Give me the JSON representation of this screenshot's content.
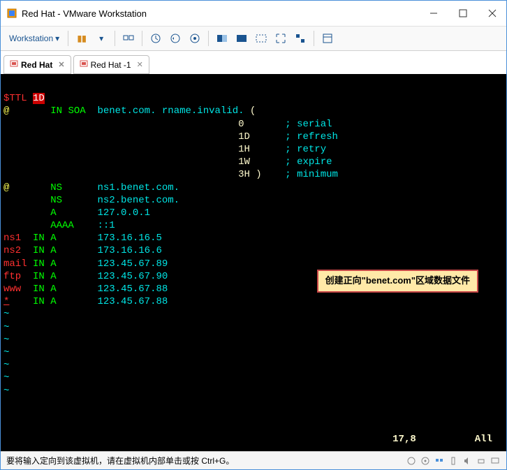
{
  "window": {
    "title": "Red Hat  - VMware Workstation"
  },
  "toolbar": {
    "menu_label": "Workstation"
  },
  "tabs": [
    {
      "label": "Red Hat"
    },
    {
      "label": "Red Hat -1"
    }
  ],
  "terminal": {
    "ttl_label": "$TTL",
    "ttl_value": "1D",
    "soa_owner": "@",
    "soa_in": "IN",
    "soa_type": "SOA",
    "soa_domain": "benet.com.",
    "soa_rname": "rname.invalid.",
    "soa_open": "(",
    "soa_params": [
      {
        "value": "0",
        "comment": "; serial"
      },
      {
        "value": "1D",
        "comment": "; refresh"
      },
      {
        "value": "1H",
        "comment": "; retry"
      },
      {
        "value": "1W",
        "comment": "; expire"
      },
      {
        "value": "3H )",
        "comment": "; minimum"
      }
    ],
    "records": [
      {
        "owner": "@",
        "in": "",
        "type": "NS",
        "data": "ns1.benet.com."
      },
      {
        "owner": "",
        "in": "",
        "type": "NS",
        "data": "ns2.benet.com."
      },
      {
        "owner": "",
        "in": "",
        "type": "A",
        "data": "127.0.0.1"
      },
      {
        "owner": "",
        "in": "",
        "type": "AAAA",
        "data": "::1"
      },
      {
        "owner": "ns1",
        "in": "IN",
        "type": "A",
        "data": "173.16.16.5"
      },
      {
        "owner": "ns2",
        "in": "IN",
        "type": "A",
        "data": "173.16.16.6"
      },
      {
        "owner": "mail",
        "in": "IN",
        "type": "A",
        "data": "123.45.67.89"
      },
      {
        "owner": "ftp",
        "in": "IN",
        "type": "A",
        "data": "123.45.67.90"
      },
      {
        "owner": "www",
        "in": "IN",
        "type": "A",
        "data": "123.45.67.88"
      },
      {
        "owner": "*",
        "in": "IN",
        "type": "A",
        "data": "123.45.67.88"
      }
    ],
    "annotation": "创建正向\"benet.com\"区域数据文件",
    "cursor_pos": "17,8",
    "view_mode": "All"
  },
  "statusbar": {
    "hint": "要将输入定向到该虚拟机，请在虚拟机内部单击或按 Ctrl+G。"
  }
}
